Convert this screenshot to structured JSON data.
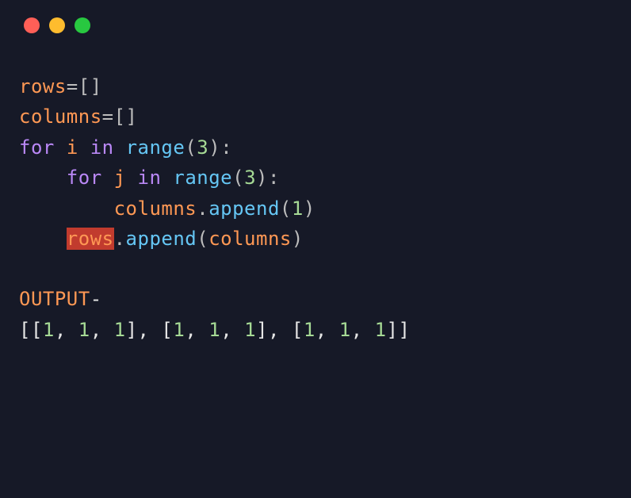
{
  "code": {
    "line1": {
      "var1": "rows",
      "eq": "=",
      "brackets": "[]"
    },
    "line2": {
      "var1": "columns",
      "eq": "=",
      "brackets": "[]"
    },
    "line3": {
      "kw1": "for",
      "var1": "i",
      "kw2": "in",
      "func": "range",
      "paren_open": "(",
      "num": "3",
      "paren_close": ")",
      "colon": ":"
    },
    "line4": {
      "indent": "    ",
      "kw1": "for",
      "var1": "j",
      "kw2": "in",
      "func": "range",
      "paren_open": "(",
      "num": "3",
      "paren_close": ")",
      "colon": ":"
    },
    "line5": {
      "indent": "        ",
      "var1": "columns",
      "dot": ".",
      "method": "append",
      "paren_open": "(",
      "num": "1",
      "paren_close": ")"
    },
    "line6": {
      "indent": "    ",
      "var1": "rows",
      "dot": ".",
      "method": "append",
      "paren_open": "(",
      "arg": "columns",
      "paren_close": ")"
    },
    "line7": {
      "label": "OUTPUT",
      "dash": "-"
    },
    "line8": {
      "open": "[[",
      "n1": "1",
      "c1": ", ",
      "n2": "1",
      "c2": ", ",
      "n3": "1",
      "mid1": "], [",
      "n4": "1",
      "c3": ", ",
      "n5": "1",
      "c4": ", ",
      "n6": "1",
      "mid2": "], [",
      "n7": "1",
      "c5": ", ",
      "n8": "1",
      "c6": ", ",
      "n9": "1",
      "close": "]]"
    }
  }
}
